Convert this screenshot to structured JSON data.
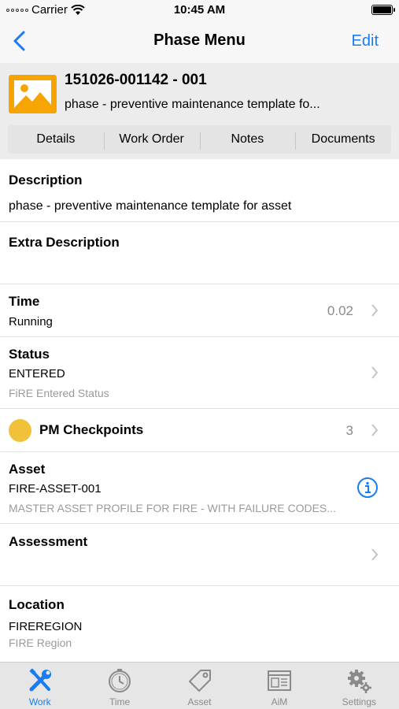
{
  "status_bar": {
    "carrier": "Carrier",
    "time": "10:45 AM"
  },
  "nav": {
    "title": "Phase Menu",
    "edit_label": "Edit"
  },
  "header": {
    "title": "151026-001142 - 001",
    "subtitle": "phase - preventive maintenance template fo...",
    "tabs": [
      "Details",
      "Work Order",
      "Notes",
      "Documents"
    ]
  },
  "rows": {
    "description": {
      "label": "Description",
      "value": "phase - preventive maintenance template for asset"
    },
    "extra_description": {
      "label": "Extra Description"
    },
    "time": {
      "label": "Time",
      "value": "Running",
      "amount": "0.02"
    },
    "status": {
      "label": "Status",
      "value": "ENTERED",
      "detail": "FiRE Entered Status"
    },
    "pm_checkpoints": {
      "label": "PM Checkpoints",
      "count": "3"
    },
    "asset": {
      "label": "Asset",
      "value": "FIRE-ASSET-001",
      "detail": "MASTER ASSET PROFILE FOR FIRE - WITH FAILURE CODES..."
    },
    "assessment": {
      "label": "Assessment"
    },
    "location": {
      "label": "Location",
      "value": "FIREREGION",
      "detail": "FIRE Region"
    }
  },
  "tabbar": {
    "items": [
      {
        "label": "Work",
        "icon": "wrench-screwdriver-icon",
        "active": true
      },
      {
        "label": "Time",
        "icon": "clock-icon",
        "active": false
      },
      {
        "label": "Asset",
        "icon": "tag-icon",
        "active": false
      },
      {
        "label": "AiM",
        "icon": "browser-window-icon",
        "active": false
      },
      {
        "label": "Settings",
        "icon": "gears-icon",
        "active": false
      }
    ]
  },
  "colors": {
    "accent": "#1a7cf2",
    "thumb_border": "#f6a400",
    "checkpoint_dot": "#f2c13a"
  }
}
